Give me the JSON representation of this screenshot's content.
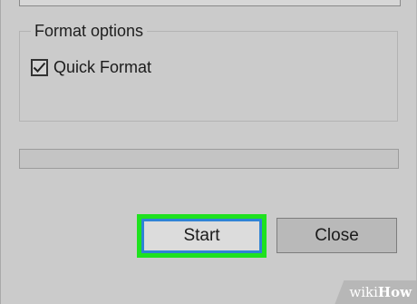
{
  "dialog": {
    "format_options": {
      "legend": "Format options",
      "quick_format": {
        "label": "Quick Format",
        "checked": true
      }
    },
    "progress": {
      "value": 0
    },
    "buttons": {
      "start_label": "Start",
      "close_label": "Close"
    }
  },
  "watermark": {
    "part1": "wiki",
    "part2": "How"
  },
  "colors": {
    "dialog_bg": "#cbcbcb",
    "highlight_ring": "#1fe21f",
    "focus_border": "#2f83d6",
    "progress_fill": "#26a0da"
  },
  "icons": {
    "checkbox_mark": "checkmark-icon"
  }
}
